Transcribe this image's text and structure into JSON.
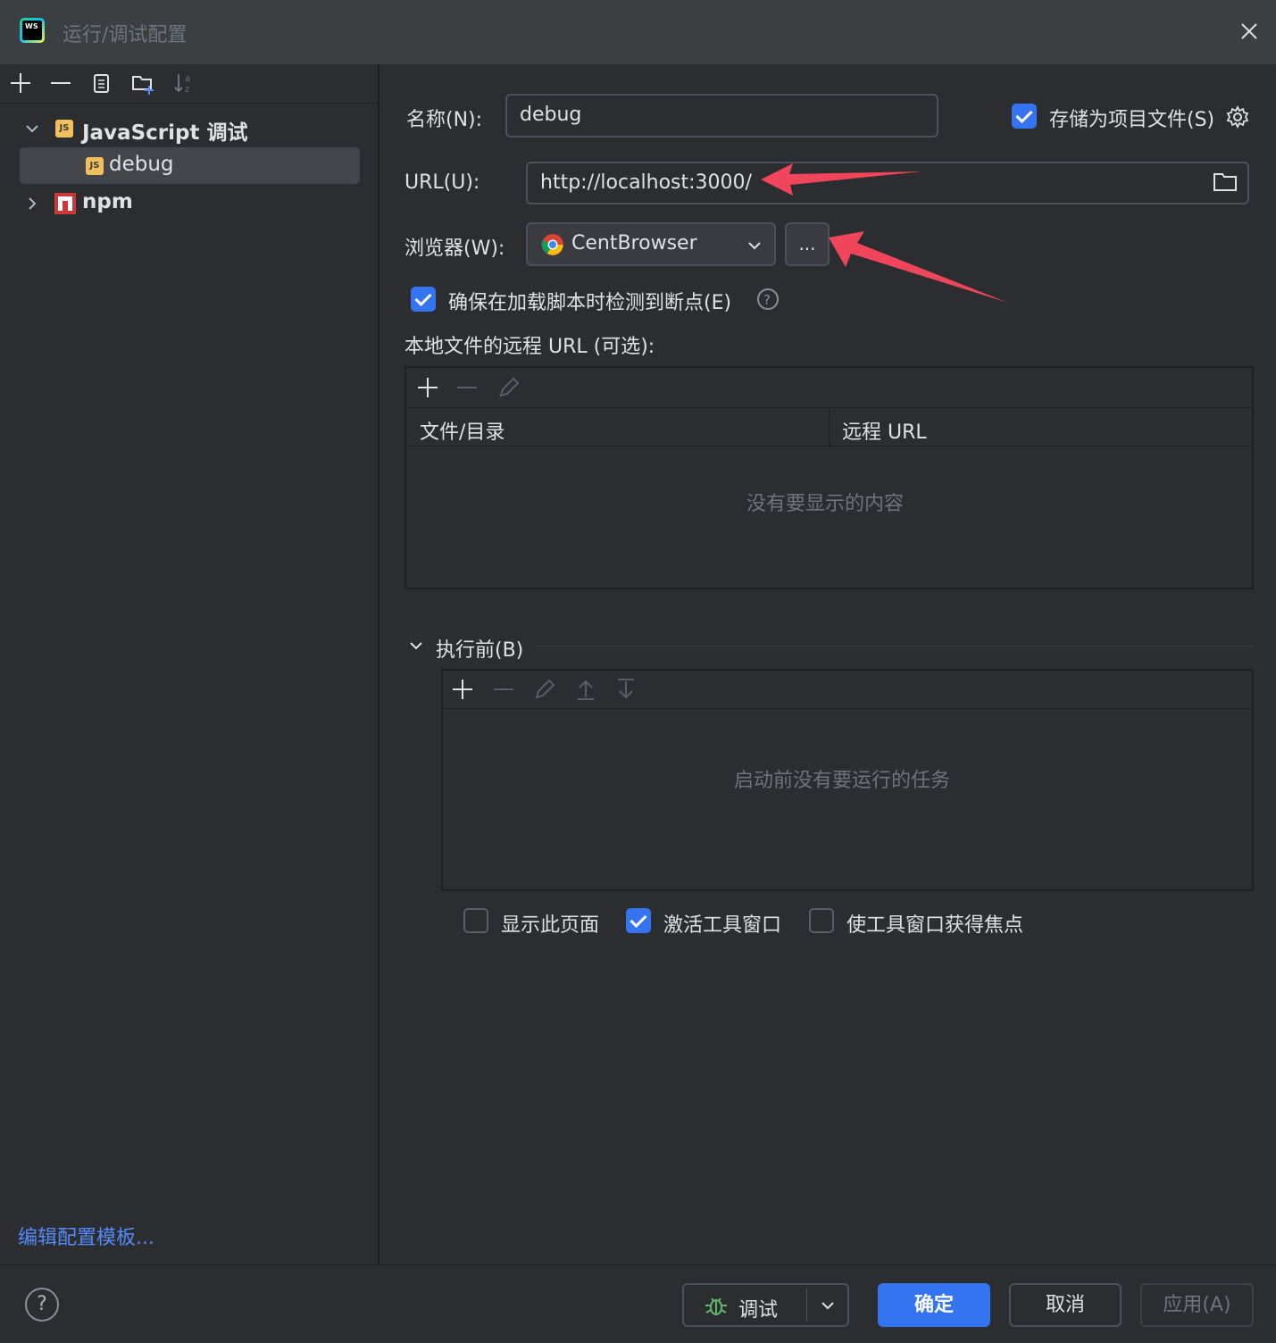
{
  "window": {
    "title": "运行/调试配置",
    "app_logo_text": "WS"
  },
  "sidebar": {
    "tree": [
      {
        "label": "JavaScript 调试",
        "expanded": true
      },
      {
        "label": "debug",
        "selected": true
      },
      {
        "label": "npm",
        "expanded": false
      }
    ],
    "edit_templates_link": "编辑配置模板..."
  },
  "form": {
    "name_label": "名称(N):",
    "name_value": "debug",
    "store_as_project_label": "存储为项目文件(S)",
    "url_label": "URL(U):",
    "url_value": "http://localhost:3000/",
    "browser_label": "浏览器(W):",
    "browser_value": "CentBrowser",
    "browser_more": "...",
    "ensure_breakpoints_label": "确保在加载脚本时检测到断点(E)",
    "remote_urls_label": "本地文件的远程 URL (可选):",
    "remote_table": {
      "columns": [
        "文件/目录",
        "远程 URL"
      ],
      "empty_text": "没有要显示的内容"
    },
    "before_launch_label": "执行前(B)",
    "before_launch_empty": "启动前没有要运行的任务",
    "options": [
      {
        "label": "显示此页面",
        "checked": false
      },
      {
        "label": "激活工具窗口",
        "checked": true
      },
      {
        "label": "使工具窗口获得焦点",
        "checked": false
      }
    ]
  },
  "footer": {
    "help": "?",
    "debug_button": "调试",
    "ok_button": "确定",
    "cancel_button": "取消",
    "apply_button": "应用(A)"
  },
  "colors": {
    "accent": "#3574f0",
    "annotation_arrow": "#f0455a",
    "background": "#2b2d30"
  }
}
